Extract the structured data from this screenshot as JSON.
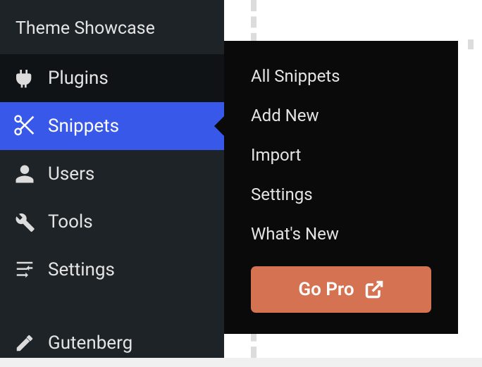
{
  "sidebar": {
    "header": "Theme Showcase",
    "items": [
      {
        "label": "Plugins",
        "icon": "plugins-icon"
      },
      {
        "label": "Snippets",
        "icon": "snippets-icon"
      },
      {
        "label": "Users",
        "icon": "users-icon"
      },
      {
        "label": "Tools",
        "icon": "tools-icon"
      },
      {
        "label": "Settings",
        "icon": "settings-icon"
      },
      {
        "label": "Gutenberg",
        "icon": "gutenberg-icon"
      }
    ]
  },
  "flyout": {
    "items": [
      "All Snippets",
      "Add New",
      "Import",
      "Settings",
      "What's New"
    ],
    "cta": "Go Pro"
  }
}
